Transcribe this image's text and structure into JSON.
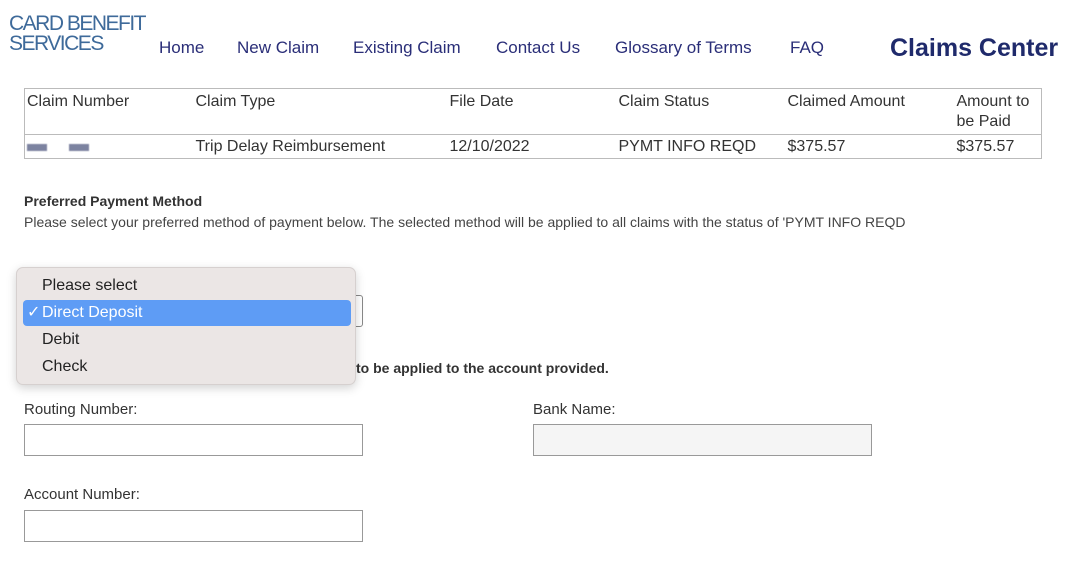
{
  "logo": {
    "line1": "CARD BENEFIT",
    "line2": "SERVICES"
  },
  "nav": [
    "Home",
    "New Claim",
    "Existing Claim",
    "Contact Us",
    "Glossary of Terms",
    "FAQ"
  ],
  "title": "Claims Center",
  "table": {
    "headers": [
      "Claim Number",
      "Claim Type",
      "File Date",
      "Claim Status",
      "Claimed Amount",
      "Amount to be Paid"
    ],
    "rows": [
      {
        "claim_type": "Trip Delay Reimbursement",
        "file_date": "12/10/2022",
        "status": "PYMT INFO REQD",
        "claimed": "$375.57",
        "to_be_paid": "$375.57"
      }
    ]
  },
  "payment": {
    "heading": "Preferred Payment Method",
    "description": "Please select your preferred method of payment below. The selected method will be applied to all claims with the status of 'PYMT INFO REQD",
    "options": [
      "Please select",
      "Direct Deposit",
      "Debit",
      "Check"
    ],
    "selected": "Direct Deposit",
    "check_mark": "✓",
    "note": "to be applied to the account provided."
  },
  "form": {
    "routing_label": "Routing Number:",
    "bank_label": "Bank Name:",
    "account_label": "Account Number:"
  }
}
